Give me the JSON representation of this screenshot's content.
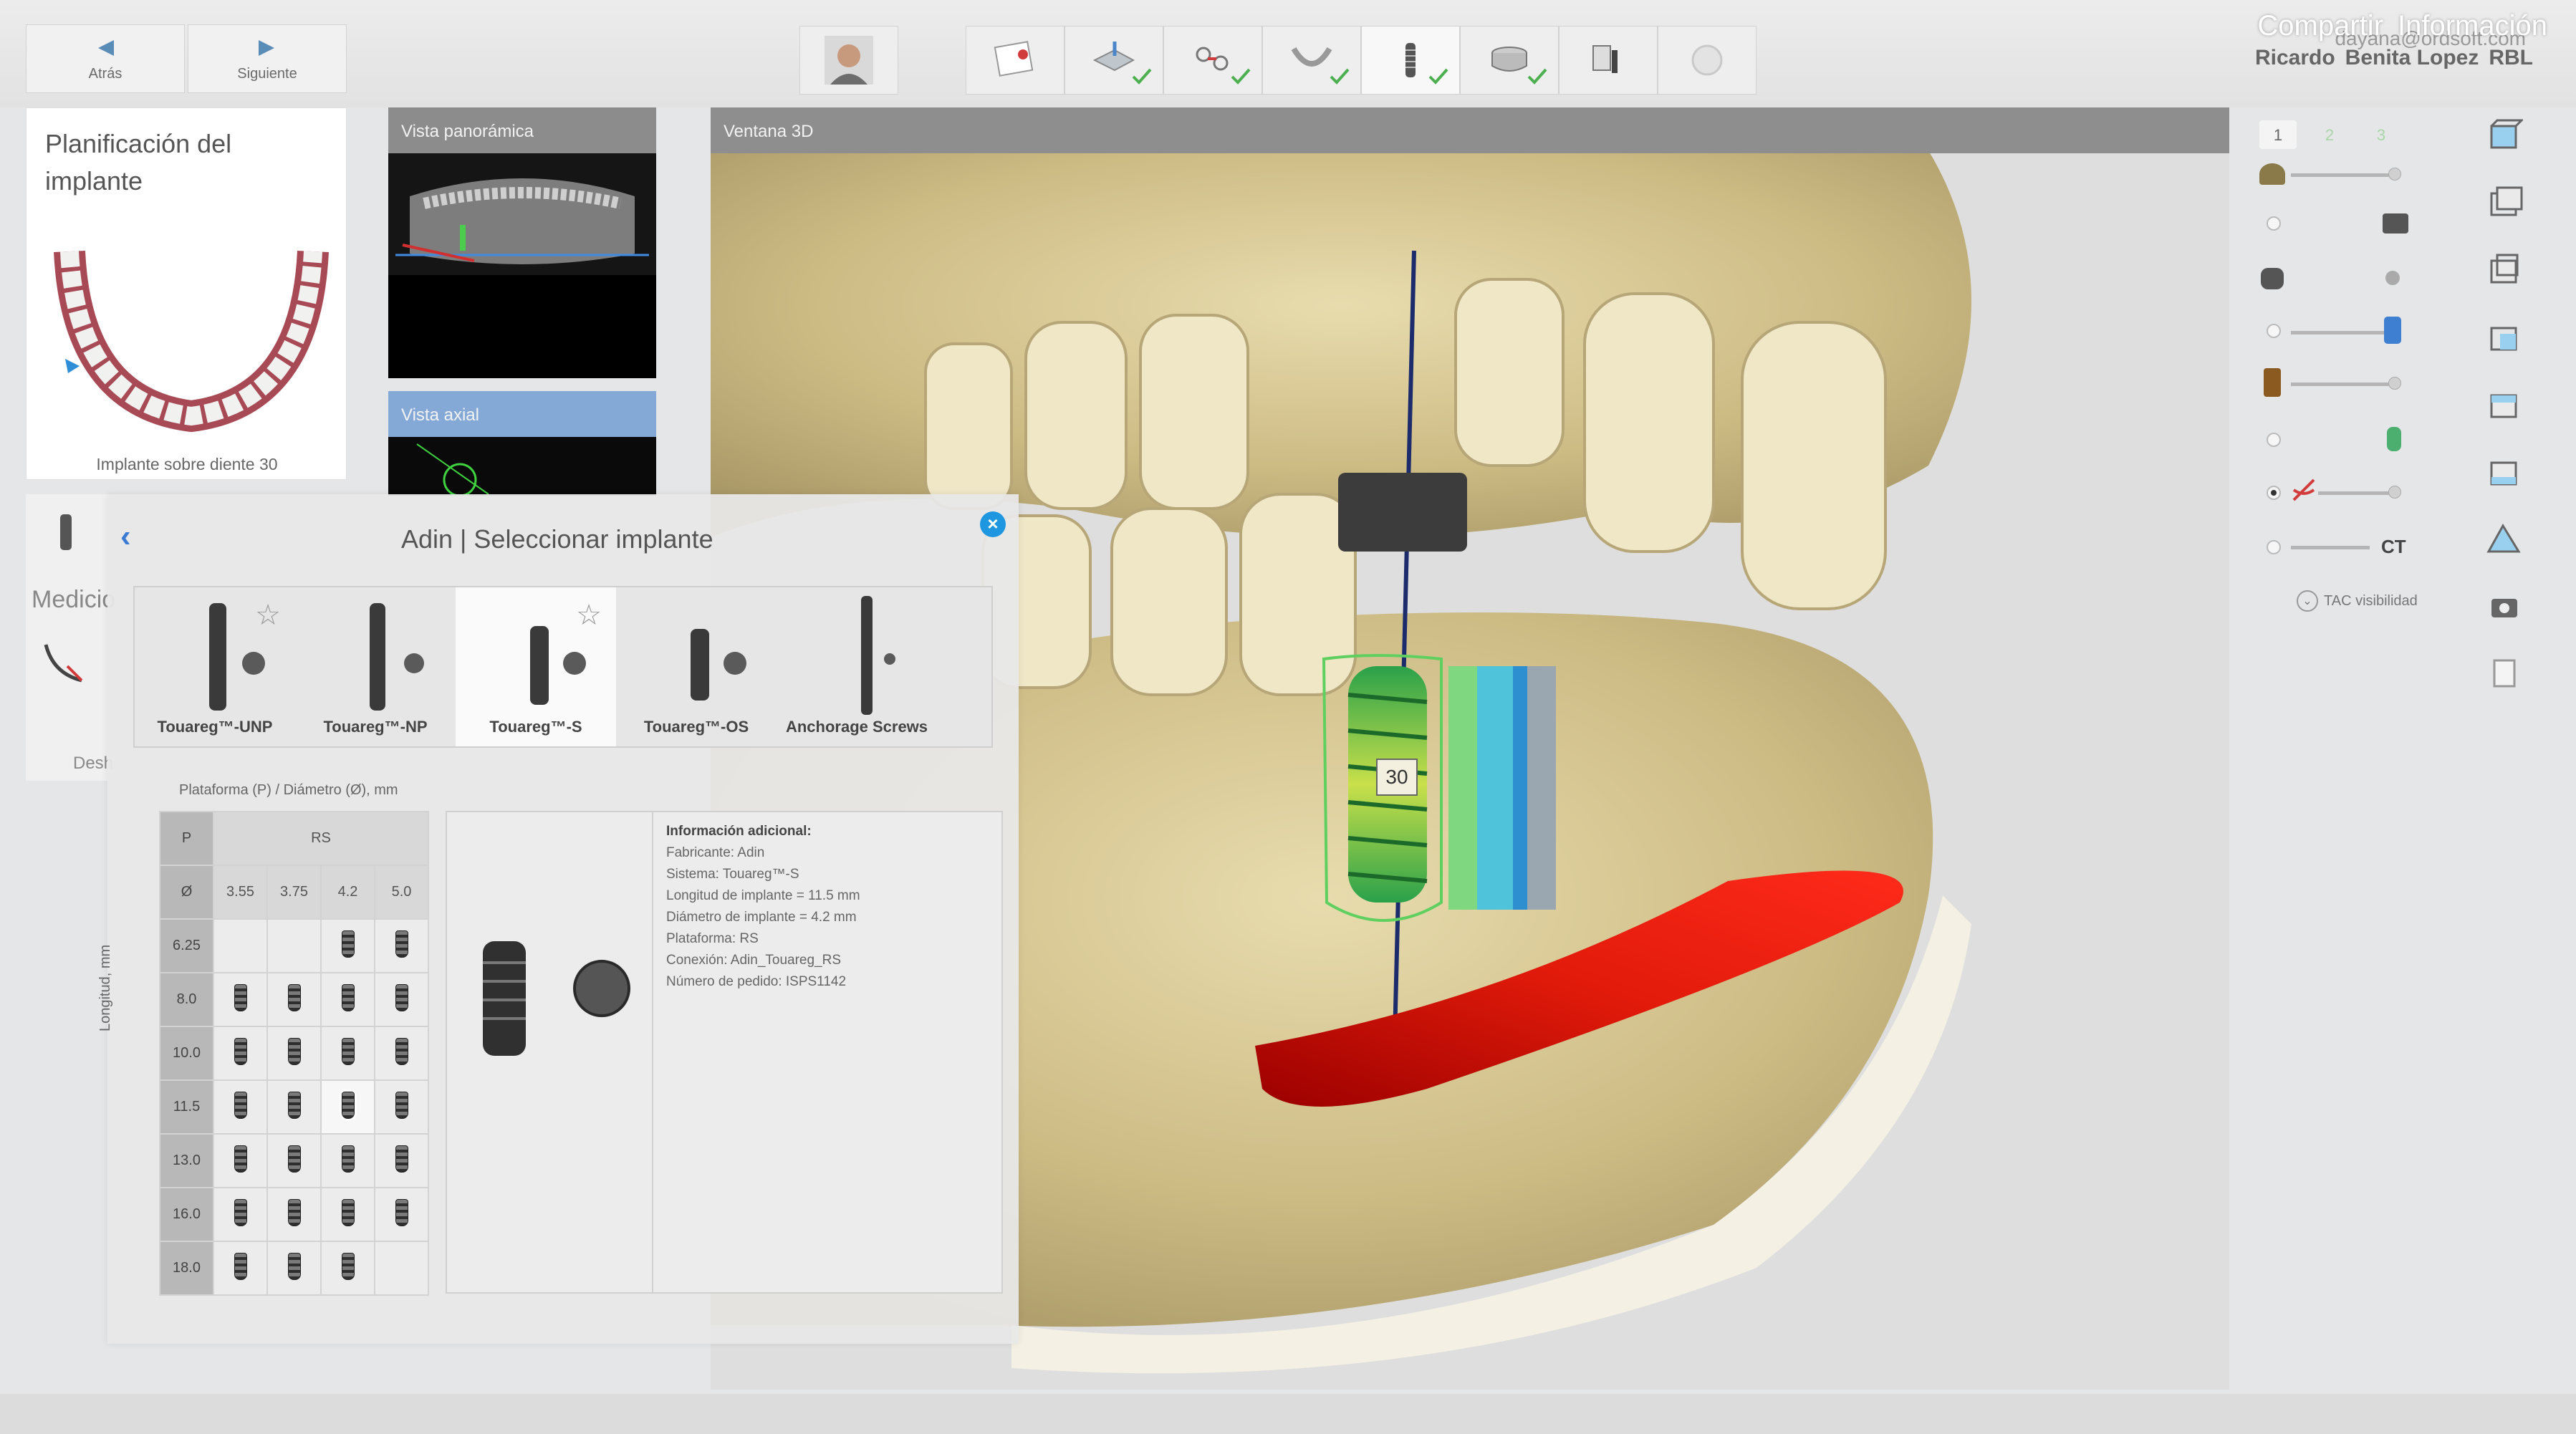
{
  "nav": {
    "back": "Atrás",
    "next": "Siguiente"
  },
  "header": {
    "share": "Compartir",
    "info": "Información",
    "email": "dayana@ordsoft.com",
    "user_first": "Ricardo",
    "user_last": "Benita Lopez",
    "user_code": "RBL"
  },
  "planning": {
    "title": "Planificación del implante",
    "caption": "Implante sobre diente 30"
  },
  "panels": {
    "panoramic": "Vista panorámica",
    "axial": "Vista axial",
    "view3d": "Ventana 3D"
  },
  "viewport": {
    "tooth_label": "30"
  },
  "right_tools": {
    "tabs": [
      "1",
      "2",
      "3"
    ],
    "ct_label": "CT",
    "tac_visibility": "TAC visibilidad"
  },
  "left_strip": {
    "measure": "Medicio",
    "label2": "Desh"
  },
  "dialog": {
    "title": "Adin | Seleccionar implante",
    "implants": [
      {
        "name": "Touareg™-UNP",
        "favorite": true
      },
      {
        "name": "Touareg™-NP",
        "favorite": false
      },
      {
        "name": "Touareg™-S",
        "favorite": true,
        "selected": true
      },
      {
        "name": "Touareg™-OS",
        "favorite": false
      },
      {
        "name": "Anchorage Screws",
        "favorite": false
      }
    ],
    "platform_label": "Plataforma (P) / Diámetro (Ø), mm",
    "length_label": "Longitud, mm",
    "grid": {
      "p_header": "P",
      "platform": "RS",
      "d_header": "Ø",
      "diameters": [
        "3.55",
        "3.75",
        "4.2",
        "5.0"
      ],
      "lengths": [
        "6.25",
        "8.0",
        "10.0",
        "11.5",
        "13.0",
        "16.0",
        "18.0"
      ]
    },
    "info": {
      "title": "Información adicional:",
      "lines": [
        "Fabricante: Adin",
        "Sistema: Touareg™-S",
        "Longitud de implante = 11.5 mm",
        "Diámetro de implante = 4.2 mm",
        "Plataforma: RS",
        "Conexión: Adin_Touareg_RS",
        "Número de pedido: ISPS1142"
      ]
    }
  }
}
